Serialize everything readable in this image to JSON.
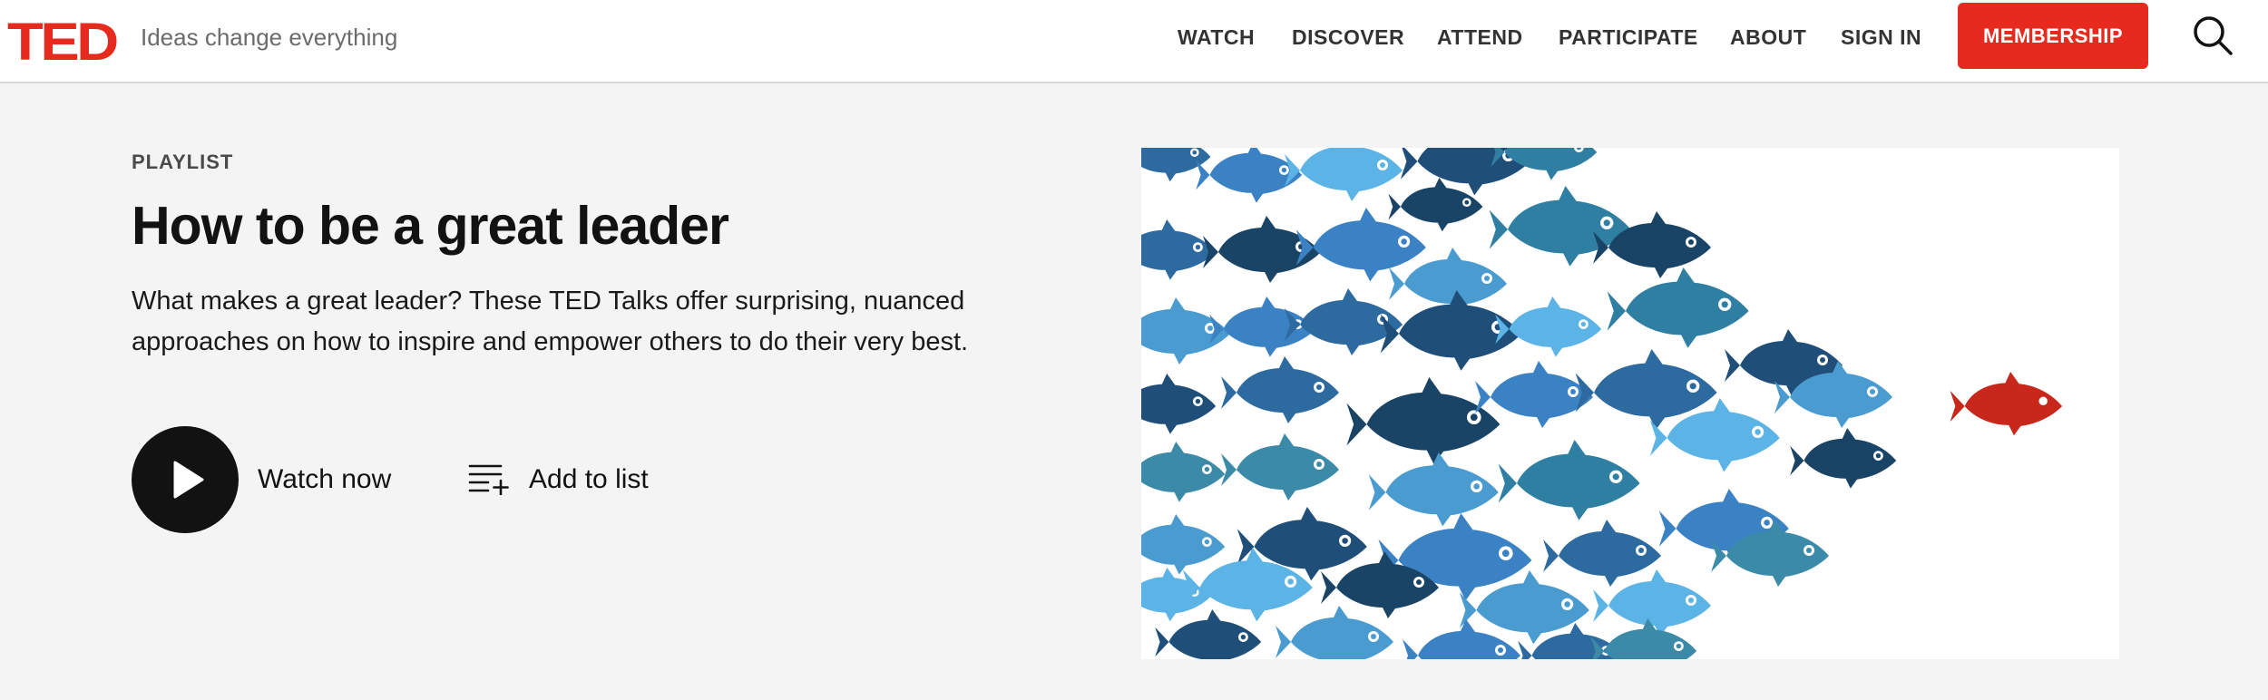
{
  "brand": {
    "logo_text": "TED",
    "tagline": "Ideas change everything",
    "accent_color": "#e62b1e"
  },
  "nav": {
    "items": [
      "WATCH",
      "DISCOVER",
      "ATTEND",
      "PARTICIPATE",
      "ABOUT",
      "SIGN IN"
    ],
    "membership_label": "MEMBERSHIP",
    "search_icon": "search-icon"
  },
  "playlist": {
    "eyebrow": "PLAYLIST",
    "title": "How to be a great leader",
    "description_line1": "What makes a great leader? These TED Talks offer surprising, nuanced",
    "description_line2": "approaches on how to inspire and empower others to do their very best.",
    "watch_label": "Watch now",
    "add_label": "Add to list"
  },
  "image": {
    "subject": "school of blue fish following one red fish",
    "fish_colors": [
      "#1f4e79",
      "#2d6a9f",
      "#3b82c4",
      "#4a9bd0",
      "#5bb4e5",
      "#2f7fa3",
      "#1a4466",
      "#3a8aa8"
    ],
    "leader_color": "#c8281c"
  }
}
